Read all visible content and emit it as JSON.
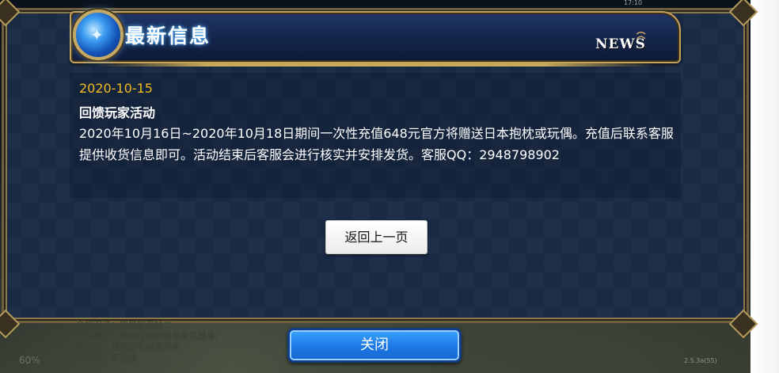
{
  "status_bar": {
    "time": "17:10"
  },
  "dialog": {
    "title": "最新信息",
    "badge": "NEWS",
    "icons": {
      "orb": "glowing-blue-orb-icon",
      "swirl": "ornament-swirl-icon"
    }
  },
  "article": {
    "date": "2020-10-15",
    "title": "回馈玩家活动",
    "body": "2020年10月16日~2020年10月18日期间一次性充值648元官方将赠送日本抱枕或玩偶。充值后联系客服提供收货信息即可。活动结束后客服会进行核实并安排发货。客服QQ：2948798902"
  },
  "buttons": {
    "back": "返回上一页",
    "close": "关闭"
  },
  "background": {
    "chat_lines": [
      "余翎羽子：四星家面缺二，",
      "九曲神乐：地属性的好像是南瓜糖果。",
      "南瓜酱：我的等我被洗完呢",
      "南瓜酱：啊还成"
    ],
    "percent": "60%",
    "version": "2.5.3a(55)"
  },
  "colors": {
    "date": "#f0bc1e",
    "frame_gold": "#c2a35e",
    "close_button": "#1f7ae6",
    "panel_blue": "#1a2a45"
  }
}
